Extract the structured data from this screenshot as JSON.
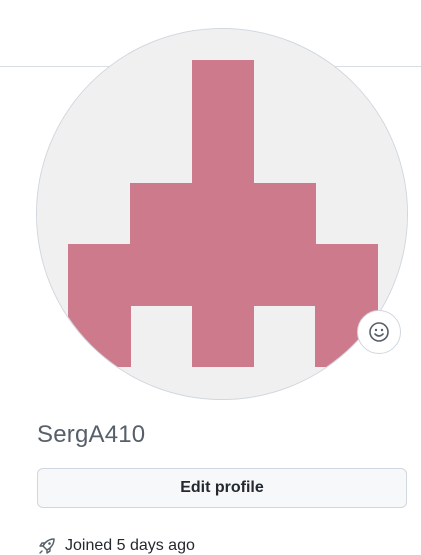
{
  "profile": {
    "username": "SergA410",
    "edit_profile_label": "Edit profile",
    "joined_text": "Joined 5 days ago",
    "avatar_color": "#cd7a8c",
    "avatar_background": "#f0f0f0"
  },
  "icons": {
    "status": "smiley-icon",
    "joined": "rocket-icon"
  }
}
